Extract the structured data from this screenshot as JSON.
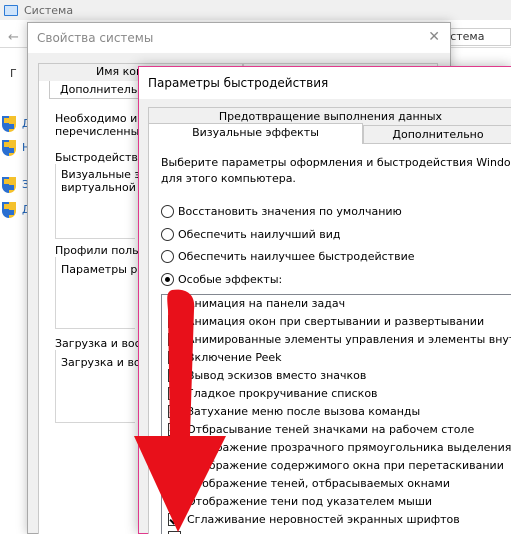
{
  "background_window": {
    "title": "Система",
    "search_text": "система",
    "heading_fragment": "Г",
    "side_links": [
      "Д",
      "Н",
      "З",
      "Д"
    ]
  },
  "system_properties": {
    "title": "Свойства системы",
    "close_glyph": "✕",
    "tabs": [
      "Имя ком",
      "Дополнительно"
    ],
    "lines": [
      "Необходимо име",
      "перечисленных в",
      "Быстродействи",
      "Визуальные эф",
      "виртуальной па",
      "Профили польз",
      "Параметры раб",
      "Загрузка и вос",
      "Загрузка и вос"
    ]
  },
  "performance_options": {
    "title": "Параметры быстродействия",
    "tabs": {
      "dep": "Предотвращение выполнения данных",
      "visual": "Визуальные эффекты",
      "advanced": "Дополнительно"
    },
    "description": [
      "Выберите параметры оформления и быстродействия Windows",
      "для этого компьютера."
    ],
    "radios": [
      {
        "label": "Восстановить значения по умолчанию",
        "selected": false
      },
      {
        "label": "Обеспечить наилучший вид",
        "selected": false
      },
      {
        "label": "Обеспечить наилучшее быстродействие",
        "selected": false
      },
      {
        "label": "Особые эффекты:",
        "selected": true
      }
    ],
    "effects": [
      {
        "label": "Анимация на панели задач",
        "checked": true
      },
      {
        "label": "Анимация окон при свертывании и развертывании",
        "checked": true
      },
      {
        "label": "Анимированные элементы управления и элементы внутри",
        "checked": true
      },
      {
        "label": "Включение Peek",
        "checked": true
      },
      {
        "label": "Вывод эскизов вместо значков",
        "checked": true
      },
      {
        "label": "Гладкое прокручивание списков",
        "checked": true
      },
      {
        "label": "Затухание меню после вызова команды",
        "checked": true
      },
      {
        "label": "Отбрасывание теней значками на рабочем столе",
        "checked": true
      },
      {
        "label": "Отображение прозрачного прямоугольника выделения",
        "checked": true
      },
      {
        "label": "Отображение содержимого окна при перетаскивании",
        "checked": true
      },
      {
        "label": "Отображение теней, отбрасываемых окнами",
        "checked": true
      },
      {
        "label": "Отображение тени под указателем мыши",
        "checked": true
      },
      {
        "label": "Сглаживание неровностей экранных шрифтов",
        "checked": true
      },
      {
        "label": "",
        "checked": false
      }
    ]
  },
  "annotation": {
    "arrow_color": "#e8101a"
  }
}
